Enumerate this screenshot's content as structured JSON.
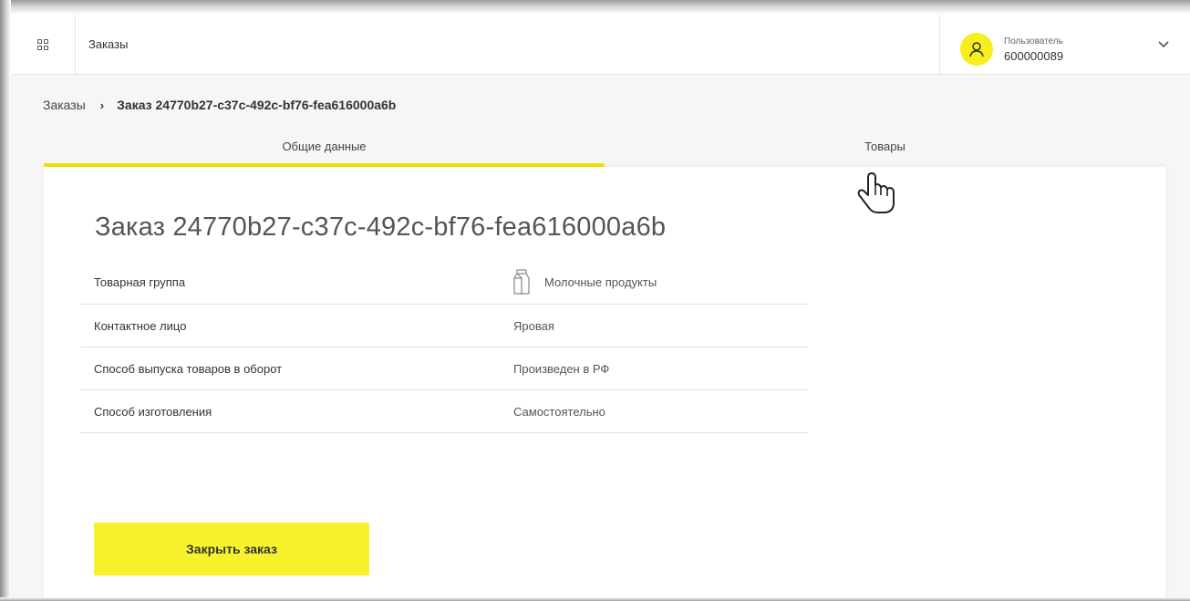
{
  "header": {
    "title": "Заказы",
    "user_role": "Пользователь",
    "user_id": "600000089"
  },
  "breadcrumb": {
    "parent": "Заказы",
    "separator": "›",
    "current": "Заказ 24770b27-c37c-492c-bf76-fea616000a6b"
  },
  "tabs": [
    {
      "label": "Общие данные",
      "active": true
    },
    {
      "label": "Товары",
      "active": false
    }
  ],
  "order": {
    "title": "Заказ 24770b27-c37c-492c-bf76-fea616000a6b",
    "rows": [
      {
        "label": "Товарная группа",
        "value": "Молочные продукты",
        "icon": "milk-carton-icon"
      },
      {
        "label": "Контактное лицо",
        "value": "Яровая"
      },
      {
        "label": "Способ выпуска товаров в оборот",
        "value": "Произведен в РФ"
      },
      {
        "label": "Способ изготовления",
        "value": "Самостоятельно"
      }
    ],
    "close_button": "Закрыть заказ"
  },
  "colors": {
    "accent": "#f7f22c",
    "tab_underline": "#f2e400",
    "avatar": "#f7ee1e"
  }
}
